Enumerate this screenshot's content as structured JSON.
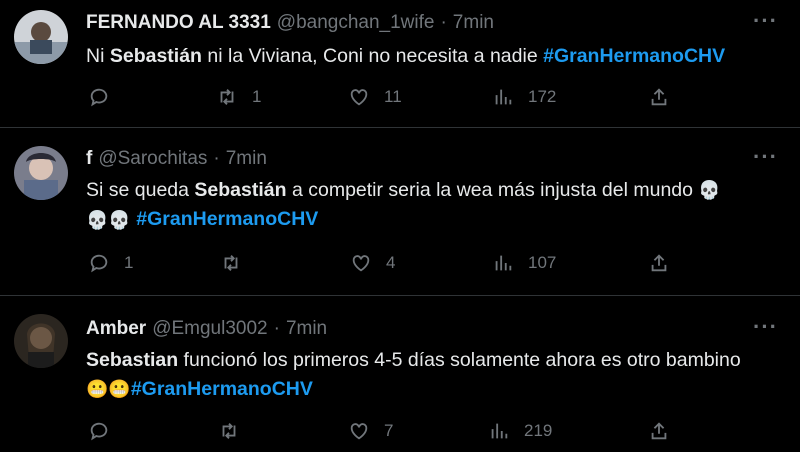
{
  "tweets": [
    {
      "name": "FERNANDO AL 3331",
      "handle": "@bangchan_1wife",
      "time": "7min",
      "text": {
        "t1": "Ni ",
        "b1": "Sebastián",
        "t2": " ni la Viviana, Coni no necesita a nadie ",
        "tag": "#GranHermanoCHV"
      },
      "replies": "",
      "retweets": "1",
      "likes": "11",
      "views": "172"
    },
    {
      "name": "f",
      "handle": "@Sarochitas",
      "time": "7min",
      "text": {
        "t1": "Si se queda ",
        "b1": "Sebastián",
        "t2": " a competir seria la wea más injusta del mundo ",
        "emoji1": "💀",
        "emoji2": "💀💀",
        "tag": "#GranHermanoCHV"
      },
      "replies": "1",
      "retweets": "",
      "likes": "4",
      "views": "107"
    },
    {
      "name": "Amber",
      "handle": "@Emgul3002",
      "time": "7min",
      "text": {
        "b1": "Sebastian",
        "t2": " funcionó los primeros 4-5 días solamente ahora es otro bambino ",
        "emoji1": "😬😬",
        "tag": "#GranHermanoCHV"
      },
      "replies": "",
      "retweets": "",
      "likes": "7",
      "views": "219"
    }
  ],
  "icons": {
    "reply": "reply-icon",
    "retweet": "retweet-icon",
    "like": "heart-icon",
    "views": "views-icon",
    "share": "share-icon",
    "more": "more-icon"
  },
  "ui": {
    "more_label": "···",
    "dot": "·"
  },
  "colors": {
    "background": "#000000",
    "text": "#e7e9ea",
    "muted": "#71767b",
    "hashtag": "#1d9bf0",
    "divider": "#2f3336"
  }
}
